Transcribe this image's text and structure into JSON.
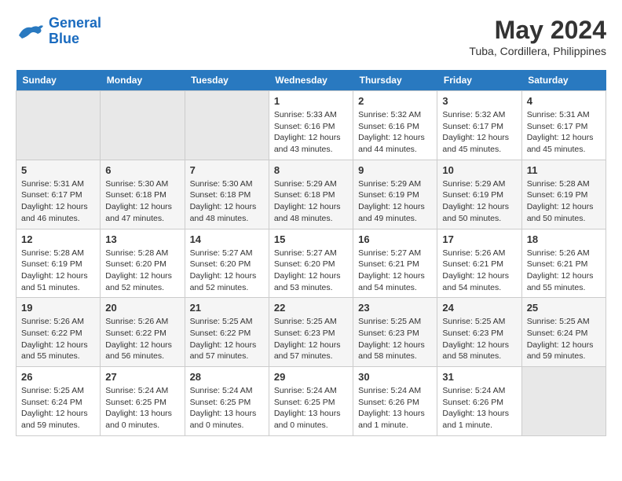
{
  "logo": {
    "line1": "General",
    "line2": "Blue"
  },
  "title": "May 2024",
  "subtitle": "Tuba, Cordillera, Philippines",
  "days_of_week": [
    "Sunday",
    "Monday",
    "Tuesday",
    "Wednesday",
    "Thursday",
    "Friday",
    "Saturday"
  ],
  "weeks": [
    [
      {
        "num": "",
        "info": ""
      },
      {
        "num": "",
        "info": ""
      },
      {
        "num": "",
        "info": ""
      },
      {
        "num": "1",
        "info": "Sunrise: 5:33 AM\nSunset: 6:16 PM\nDaylight: 12 hours and 43 minutes."
      },
      {
        "num": "2",
        "info": "Sunrise: 5:32 AM\nSunset: 6:16 PM\nDaylight: 12 hours and 44 minutes."
      },
      {
        "num": "3",
        "info": "Sunrise: 5:32 AM\nSunset: 6:17 PM\nDaylight: 12 hours and 45 minutes."
      },
      {
        "num": "4",
        "info": "Sunrise: 5:31 AM\nSunset: 6:17 PM\nDaylight: 12 hours and 45 minutes."
      }
    ],
    [
      {
        "num": "5",
        "info": "Sunrise: 5:31 AM\nSunset: 6:17 PM\nDaylight: 12 hours and 46 minutes."
      },
      {
        "num": "6",
        "info": "Sunrise: 5:30 AM\nSunset: 6:18 PM\nDaylight: 12 hours and 47 minutes."
      },
      {
        "num": "7",
        "info": "Sunrise: 5:30 AM\nSunset: 6:18 PM\nDaylight: 12 hours and 48 minutes."
      },
      {
        "num": "8",
        "info": "Sunrise: 5:29 AM\nSunset: 6:18 PM\nDaylight: 12 hours and 48 minutes."
      },
      {
        "num": "9",
        "info": "Sunrise: 5:29 AM\nSunset: 6:19 PM\nDaylight: 12 hours and 49 minutes."
      },
      {
        "num": "10",
        "info": "Sunrise: 5:29 AM\nSunset: 6:19 PM\nDaylight: 12 hours and 50 minutes."
      },
      {
        "num": "11",
        "info": "Sunrise: 5:28 AM\nSunset: 6:19 PM\nDaylight: 12 hours and 50 minutes."
      }
    ],
    [
      {
        "num": "12",
        "info": "Sunrise: 5:28 AM\nSunset: 6:19 PM\nDaylight: 12 hours and 51 minutes."
      },
      {
        "num": "13",
        "info": "Sunrise: 5:28 AM\nSunset: 6:20 PM\nDaylight: 12 hours and 52 minutes."
      },
      {
        "num": "14",
        "info": "Sunrise: 5:27 AM\nSunset: 6:20 PM\nDaylight: 12 hours and 52 minutes."
      },
      {
        "num": "15",
        "info": "Sunrise: 5:27 AM\nSunset: 6:20 PM\nDaylight: 12 hours and 53 minutes."
      },
      {
        "num": "16",
        "info": "Sunrise: 5:27 AM\nSunset: 6:21 PM\nDaylight: 12 hours and 54 minutes."
      },
      {
        "num": "17",
        "info": "Sunrise: 5:26 AM\nSunset: 6:21 PM\nDaylight: 12 hours and 54 minutes."
      },
      {
        "num": "18",
        "info": "Sunrise: 5:26 AM\nSunset: 6:21 PM\nDaylight: 12 hours and 55 minutes."
      }
    ],
    [
      {
        "num": "19",
        "info": "Sunrise: 5:26 AM\nSunset: 6:22 PM\nDaylight: 12 hours and 55 minutes."
      },
      {
        "num": "20",
        "info": "Sunrise: 5:26 AM\nSunset: 6:22 PM\nDaylight: 12 hours and 56 minutes."
      },
      {
        "num": "21",
        "info": "Sunrise: 5:25 AM\nSunset: 6:22 PM\nDaylight: 12 hours and 57 minutes."
      },
      {
        "num": "22",
        "info": "Sunrise: 5:25 AM\nSunset: 6:23 PM\nDaylight: 12 hours and 57 minutes."
      },
      {
        "num": "23",
        "info": "Sunrise: 5:25 AM\nSunset: 6:23 PM\nDaylight: 12 hours and 58 minutes."
      },
      {
        "num": "24",
        "info": "Sunrise: 5:25 AM\nSunset: 6:23 PM\nDaylight: 12 hours and 58 minutes."
      },
      {
        "num": "25",
        "info": "Sunrise: 5:25 AM\nSunset: 6:24 PM\nDaylight: 12 hours and 59 minutes."
      }
    ],
    [
      {
        "num": "26",
        "info": "Sunrise: 5:25 AM\nSunset: 6:24 PM\nDaylight: 12 hours and 59 minutes."
      },
      {
        "num": "27",
        "info": "Sunrise: 5:24 AM\nSunset: 6:25 PM\nDaylight: 13 hours and 0 minutes."
      },
      {
        "num": "28",
        "info": "Sunrise: 5:24 AM\nSunset: 6:25 PM\nDaylight: 13 hours and 0 minutes."
      },
      {
        "num": "29",
        "info": "Sunrise: 5:24 AM\nSunset: 6:25 PM\nDaylight: 13 hours and 0 minutes."
      },
      {
        "num": "30",
        "info": "Sunrise: 5:24 AM\nSunset: 6:26 PM\nDaylight: 13 hours and 1 minute."
      },
      {
        "num": "31",
        "info": "Sunrise: 5:24 AM\nSunset: 6:26 PM\nDaylight: 13 hours and 1 minute."
      },
      {
        "num": "",
        "info": ""
      }
    ]
  ]
}
